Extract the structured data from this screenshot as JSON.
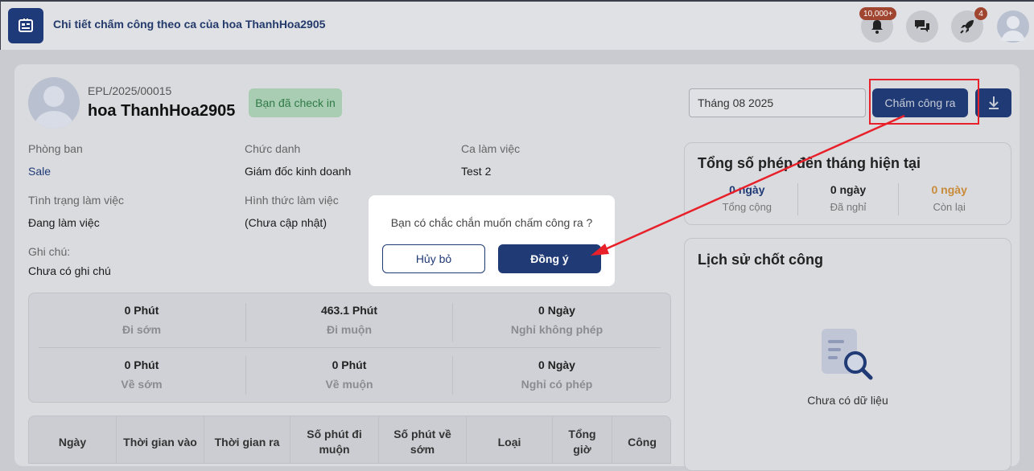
{
  "header": {
    "title": "Chi tiết chấm công theo ca của hoa ThanhHoa2905",
    "notifications_badge": "10,000+",
    "rocket_badge": "4"
  },
  "employee": {
    "code": "EPL/2025/00015",
    "name": "hoa ThanhHoa2905",
    "status_badge": "Bạn đã check in"
  },
  "fields": {
    "department_label": "Phòng ban",
    "department": "Sale",
    "position_label": "Chức danh",
    "position": "Giám đốc kinh doanh",
    "shift_label": "Ca làm việc",
    "shift": "Test 2",
    "work_status_label": "Tình trạng làm việc",
    "work_status": "Đang làm việc",
    "work_type_label": "Hình thức làm việc",
    "work_type": "(Chưa cập nhật)",
    "note_label": "Ghi chú:",
    "note": "Chưa có ghi chú"
  },
  "controls": {
    "month": "Tháng 08 2025",
    "checkout_label": "Chấm công ra"
  },
  "leave_summary": {
    "title": "Tổng số phép đến tháng hiện tại",
    "items": [
      {
        "value": "0 ngày",
        "label": "Tổng cộng"
      },
      {
        "value": "0 ngày",
        "label": "Đã nghỉ"
      },
      {
        "value": "0 ngày",
        "label": "Còn lại"
      }
    ]
  },
  "history": {
    "title": "Lịch sử chốt công",
    "empty": "Chưa có dữ liệu"
  },
  "stats": [
    {
      "value": "0 Phút",
      "label": "Đi sớm"
    },
    {
      "value": "463.1 Phút",
      "label": "Đi muộn"
    },
    {
      "value": "0 Ngày",
      "label": "Nghỉ không phép"
    },
    {
      "value": "0 Phút",
      "label": "Về sớm"
    },
    {
      "value": "0 Phút",
      "label": "Về muộn"
    },
    {
      "value": "0 Ngày",
      "label": "Nghỉ có phép"
    }
  ],
  "table": {
    "headers": [
      "Ngày",
      "Thời gian vào",
      "Thời gian ra",
      "Số phút đi muộn",
      "Số phút về sớm",
      "Loại",
      "Tổng giờ",
      "Công"
    ]
  },
  "modal": {
    "message": "Bạn có chắc chắn muốn chấm công ra ?",
    "cancel": "Hủy bỏ",
    "confirm": "Đồng ý"
  },
  "colors": {
    "primary": "#1f3a75",
    "success_bg": "#a9cdb2",
    "warning": "#c98a3a",
    "annotation": "#e8202a"
  }
}
